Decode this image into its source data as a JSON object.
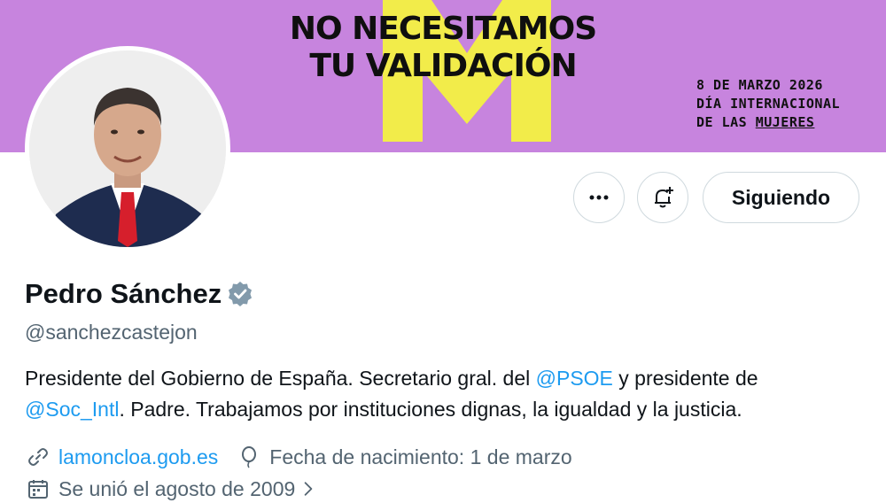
{
  "banner": {
    "headline_line1": "NO NECESITAMOS",
    "headline_line2": "TU VALIDACIÓN",
    "date_line1": "8 DE MARZO 2026",
    "date_line2": "DÍA INTERNACIONAL",
    "date_line3_a": "DE LAS ",
    "date_line3_b": "MUJERES",
    "bg_color": "#c784de",
    "accent_color": "#f2ec4a"
  },
  "actions": {
    "more_icon": "more-dots-icon",
    "notify_icon": "bell-plus-icon",
    "follow_label": "Siguiendo"
  },
  "profile": {
    "name": "Pedro Sánchez",
    "verified_icon": "verified-badge-icon",
    "handle": "@sanchezcastejon",
    "bio_line1_a": "Presidente del Gobierno de España. Secretario gral. del ",
    "bio_line1_mention": "@PSOE",
    "bio_line1_b": " y presidente de",
    "bio_line2_mention": "@Soc_Intl",
    "bio_line2_b": ". Padre. Trabajamos por instituciones dignas, la igualdad y la justicia.",
    "website": "lamoncloa.gob.es",
    "birthday": "Fecha de nacimiento: 1 de marzo",
    "joined": "Se unió el agosto de 2009"
  },
  "colors": {
    "link": "#1d9bf0",
    "secondary_text": "#536471",
    "verified": "#829aab"
  }
}
